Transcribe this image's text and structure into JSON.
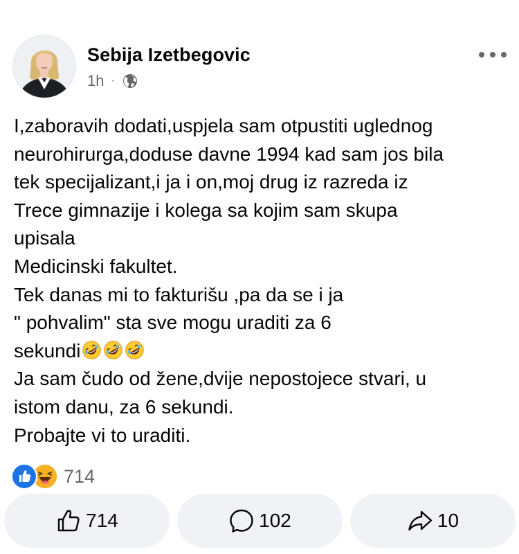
{
  "post": {
    "author_name": "Sebija Izetbegovic",
    "time": "1h",
    "separator": "·",
    "audience_icon": "globe-icon",
    "more_icon": "more-horizontal-icon",
    "lines": [
      "I,zaboravih dodati,uspjela sam otpustiti uglednog",
      "neurohirurga,doduse davne 1994 kad sam jos bila",
      "tek specijalizant,i ja i on,moj drug iz razreda iz",
      "Trece gimnazije i kolega sa kojim sam skupa",
      "upisala",
      "Medicinski fakultet.",
      "Tek danas mi to  fakturišu ,pa da se i ja",
      "\" pohvalim\" sta sve mogu uraditi za 6",
      "sekundi",
      "Ja sam čudo od žene,dvije nepostojece stvari, u",
      "istom danu, za 6  sekundi.",
      "Probajte vi to uraditi."
    ],
    "line_emojis": [
      "rolling-on-floor-laughing-emoji",
      "rolling-on-floor-laughing-emoji",
      "rolling-on-floor-laughing-emoji"
    ]
  },
  "reactions": {
    "types": [
      "like",
      "haha"
    ],
    "total": "714"
  },
  "actions": {
    "like": {
      "icon": "thumbs-up-icon",
      "count": "714"
    },
    "comment": {
      "icon": "comment-bubble-icon",
      "count": "102"
    },
    "share": {
      "icon": "share-arrow-icon",
      "count": "10"
    }
  },
  "colors": {
    "text": "#050505",
    "secondary": "#65676b",
    "like_blue": "#1b74e4",
    "haha_yellow": "#f7b125",
    "pill_bg": "#f0f2f5"
  }
}
